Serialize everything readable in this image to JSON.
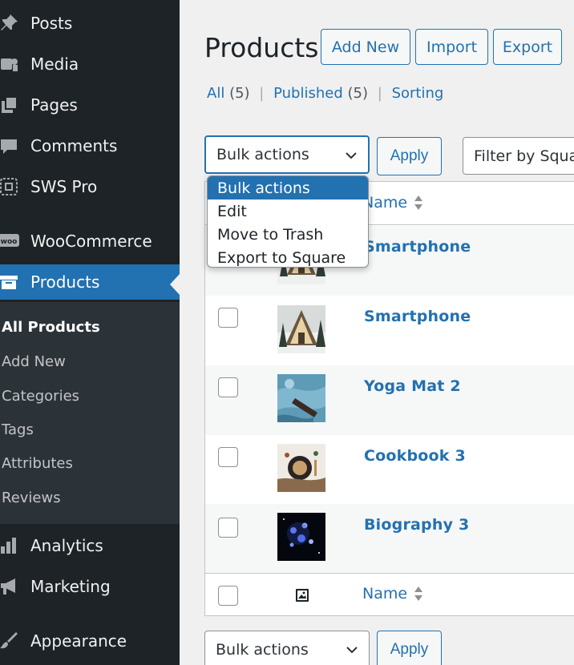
{
  "sidebar": {
    "menu": [
      {
        "label": "Posts",
        "icon": "pin-icon"
      },
      {
        "label": "Media",
        "icon": "media-icon"
      },
      {
        "label": "Pages",
        "icon": "pages-icon"
      },
      {
        "label": "Comments",
        "icon": "comment-icon"
      },
      {
        "label": "SWS Pro",
        "icon": "sws-icon"
      },
      {
        "label": "WooCommerce",
        "icon": "woo-icon"
      },
      {
        "label": "Products",
        "icon": "archive-icon"
      },
      {
        "label": "Analytics",
        "icon": "bar-chart-icon"
      },
      {
        "label": "Marketing",
        "icon": "megaphone-icon"
      },
      {
        "label": "Appearance",
        "icon": "brush-icon"
      }
    ],
    "woo_icon_text": "woo",
    "submenu": [
      "All Products",
      "Add New",
      "Categories",
      "Tags",
      "Attributes",
      "Reviews"
    ]
  },
  "header": {
    "title": "Products",
    "buttons": [
      "Add New",
      "Import",
      "Export"
    ]
  },
  "views": {
    "all": "All",
    "all_count": "(5)",
    "published": "Published",
    "published_count": "(5)",
    "sorting": "Sorting",
    "separator": "|"
  },
  "actions": {
    "bulk_label": "Bulk actions",
    "apply": "Apply",
    "filter": "Filter by Square"
  },
  "dropdown": {
    "options": [
      "Bulk actions",
      "Edit",
      "Move to Trash",
      "Export to Square"
    ]
  },
  "table": {
    "col_name": "Name",
    "rows": [
      {
        "name": "Smartphone"
      },
      {
        "name": "Smartphone"
      },
      {
        "name": "Yoga Mat 2"
      },
      {
        "name": "Cookbook 3"
      },
      {
        "name": "Biography 3"
      }
    ]
  },
  "colors": {
    "sidebar": "#1d2327",
    "submenu": "#2c3338",
    "accent": "#2271b1",
    "background": "#f0f0f1"
  }
}
